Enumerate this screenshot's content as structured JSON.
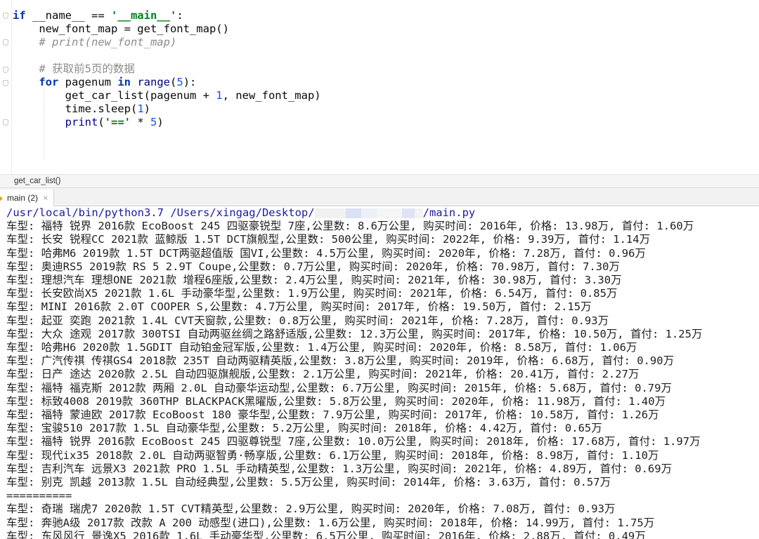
{
  "editor": {
    "lines": [
      [
        {
          "t": "if ",
          "c": "kw"
        },
        {
          "t": "__name__ == ",
          "c": "dunder"
        },
        {
          "t": "'__main__'",
          "c": "str"
        },
        {
          "t": ":",
          "c": ""
        }
      ],
      [
        {
          "t": "    new_font_map = get_font_map()",
          "c": ""
        }
      ],
      [
        {
          "t": "    # print(new_font_map)",
          "c": "cmt"
        }
      ],
      [
        {
          "t": "",
          "c": ""
        }
      ],
      [
        {
          "t": "    # 获取前5页的数据",
          "c": "cmt2"
        }
      ],
      [
        {
          "t": "    ",
          "c": ""
        },
        {
          "t": "for",
          "c": "kw"
        },
        {
          "t": " pagenum ",
          "c": ""
        },
        {
          "t": "in",
          "c": "kw"
        },
        {
          "t": " ",
          "c": ""
        },
        {
          "t": "range",
          "c": "bi"
        },
        {
          "t": "(",
          "c": ""
        },
        {
          "t": "5",
          "c": "num"
        },
        {
          "t": "):",
          "c": ""
        }
      ],
      [
        {
          "t": "        get_car_list(pagenum + ",
          "c": ""
        },
        {
          "t": "1",
          "c": "num"
        },
        {
          "t": ", new_font_map)",
          "c": ""
        }
      ],
      [
        {
          "t": "        time.sleep(",
          "c": ""
        },
        {
          "t": "1",
          "c": "num"
        },
        {
          "t": ")",
          "c": ""
        }
      ],
      [
        {
          "t": "        ",
          "c": ""
        },
        {
          "t": "print",
          "c": "bi"
        },
        {
          "t": "(",
          "c": ""
        },
        {
          "t": "'=='",
          "c": "str"
        },
        {
          "t": " * ",
          "c": ""
        },
        {
          "t": "5",
          "c": "num"
        },
        {
          "t": ")",
          "c": ""
        }
      ]
    ]
  },
  "breadcrumb": "get_car_list()",
  "run_tab": {
    "label": "main (2)",
    "close": "×"
  },
  "console": {
    "command_prefix": "/usr/local/bin/python3.7 /Users/xingag/Desktop/",
    "command_suffix": "/main.py",
    "lines": [
      "车型: 福特 锐界 2016款 EcoBoost 245 四驱豪锐型 7座,公里数: 8.6万公里, 购买时间: 2016年, 价格: 13.98万, 首付: 1.60万",
      "车型: 长安 锐程CC 2021款 蓝鲸版 1.5T DCT旗舰型,公里数: 500公里, 购买时间: 2022年, 价格: 9.39万, 首付: 1.14万",
      "车型: 哈弗M6 2019款 1.5T DCT两驱超值版 国VI,公里数: 4.5万公里, 购买时间: 2020年, 价格: 7.28万, 首付: 0.96万",
      "车型: 奥迪RS5 2019款 RS 5 2.9T Coupe,公里数: 0.7万公里, 购买时间: 2020年, 价格: 70.98万, 首付: 7.30万",
      "车型: 理想汽车 理想ONE 2021款 增程6座版,公里数: 2.4万公里, 购买时间: 2021年, 价格: 30.98万, 首付: 3.30万",
      "车型: 长安欧尚X5 2021款 1.6L 手动豪华型,公里数: 1.9万公里, 购买时间: 2021年, 价格: 6.54万, 首付: 0.85万",
      "车型: MINI 2016款 2.0T COOPER S,公里数: 4.7万公里, 购买时间: 2017年, 价格: 19.50万, 首付: 2.15万",
      "车型: 起亚 奕跑 2021款 1.4L CVT天窗款,公里数: 0.8万公里, 购买时间: 2021年, 价格: 7.28万, 首付: 0.93万",
      "车型: 大众 途观 2017款 300TSI 自动两驱丝绸之路舒适版,公里数: 12.3万公里, 购买时间: 2017年, 价格: 10.50万, 首付: 1.25万",
      "车型: 哈弗H6 2020款 1.5GDIT 自动铂金冠军版,公里数: 1.4万公里, 购买时间: 2020年, 价格: 8.58万, 首付: 1.06万",
      "车型: 广汽传祺 传祺GS4 2018款 235T 自动两驱精英版,公里数: 3.8万公里, 购买时间: 2019年, 价格: 6.68万, 首付: 0.90万",
      "车型: 日产 途达 2020款 2.5L 自动四驱旗舰版,公里数: 2.1万公里, 购买时间: 2021年, 价格: 20.41万, 首付: 2.27万",
      "车型: 福特 福克斯 2012款 两厢 2.0L 自动豪华运动型,公里数: 6.7万公里, 购买时间: 2015年, 价格: 5.68万, 首付: 0.79万",
      "车型: 标致4008 2019款 360THP BLACKPACK黑曜版,公里数: 5.8万公里, 购买时间: 2020年, 价格: 11.98万, 首付: 1.40万",
      "车型: 福特 蒙迪欧 2017款 EcoBoost 180 豪华型,公里数: 7.9万公里, 购买时间: 2017年, 价格: 10.58万, 首付: 1.26万",
      "车型: 宝骏510 2017款 1.5L 自动豪华型,公里数: 5.2万公里, 购买时间: 2018年, 价格: 4.42万, 首付: 0.65万",
      "车型: 福特 锐界 2016款 EcoBoost 245 四驱尊锐型 7座,公里数: 10.0万公里, 购买时间: 2018年, 价格: 17.68万, 首付: 1.97万",
      "车型: 现代ix35 2018款 2.0L 自动两驱智勇·畅享版,公里数: 6.1万公里, 购买时间: 2018年, 价格: 8.98万, 首付: 1.10万",
      "车型: 吉利汽车 远景X3 2021款 PRO 1.5L 手动精英型,公里数: 1.3万公里, 购买时间: 2021年, 价格: 4.89万, 首付: 0.69万",
      "车型: 别克 凯越 2013款 1.5L 自动经典型,公里数: 5.5万公里, 购买时间: 2014年, 价格: 3.63万, 首付: 0.57万",
      "==========",
      "车型: 奇瑞 瑞虎7 2020款 1.5T CVT精英型,公里数: 2.9万公里, 购买时间: 2020年, 价格: 7.08万, 首付: 0.93万",
      "车型: 奔驰A级 2017款 改款 A 200 动感型(进口),公里数: 1.6万公里, 购买时间: 2018年, 价格: 14.99万, 首付: 1.75万",
      "车型: 东风风行 景逸X5 2016款 1.6L 手动豪华型,公里数: 6.5万公里, 购买时间: 2016年, 价格: 2.88万, 首付: 0.49万"
    ]
  }
}
